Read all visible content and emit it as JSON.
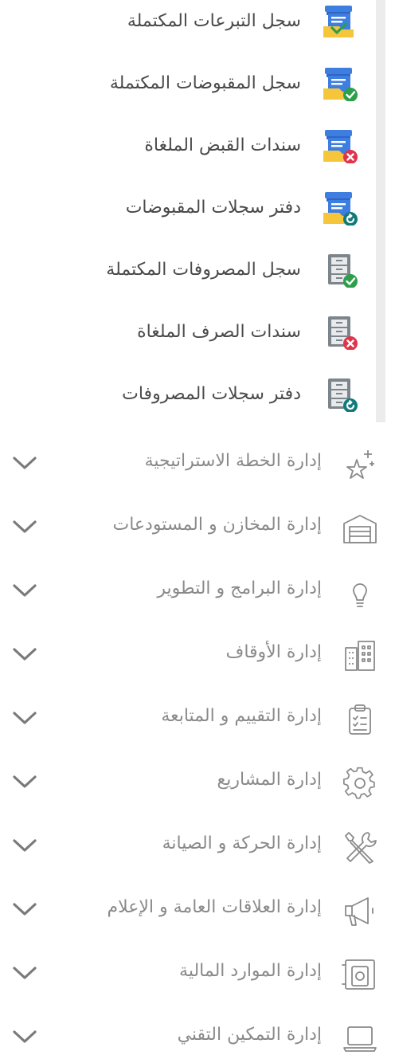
{
  "submenu": [
    {
      "label": "سجل التبرعات المكتملة",
      "icon": "donations-completed-icon"
    },
    {
      "label": "سجل المقبوضات المكتملة",
      "icon": "receipts-completed-icon"
    },
    {
      "label": "سندات القبض الملغاة",
      "icon": "receipts-cancelled-icon"
    },
    {
      "label": "دفتر سجلات المقبوضات",
      "icon": "receipts-ledger-icon"
    },
    {
      "label": "سجل المصروفات المكتملة",
      "icon": "expenses-completed-icon"
    },
    {
      "label": "سندات الصرف الملغاة",
      "icon": "expenses-cancelled-icon"
    },
    {
      "label": "دفتر سجلات المصروفات",
      "icon": "expenses-ledger-icon"
    }
  ],
  "menu": [
    {
      "label": "إدارة الخطة الاستراتيجية",
      "icon": "sparkle-star-icon"
    },
    {
      "label": "إدارة المخازن و المستودعات",
      "icon": "warehouse-icon"
    },
    {
      "label": "إدارة البرامج و التطوير",
      "icon": "lightbulb-icon"
    },
    {
      "label": "إدارة الأوقاف",
      "icon": "buildings-icon"
    },
    {
      "label": "إدارة التقييم و المتابعة",
      "icon": "clipboard-checklist-icon"
    },
    {
      "label": "إدارة المشاريع",
      "icon": "gear-icon"
    },
    {
      "label": "إدارة الحركة و الصيانة",
      "icon": "tools-icon"
    },
    {
      "label": "إدارة العلاقات العامة و الإعلام",
      "icon": "megaphone-icon"
    },
    {
      "label": "إدارة الموارد المالية",
      "icon": "safe-icon"
    },
    {
      "label": "إدارة التمكين التقني",
      "icon": "laptop-icon"
    }
  ],
  "colors": {
    "folder_blue": "#2f66c4",
    "folder_yellow": "#f5c63c",
    "cabinet_gray": "#7c858c",
    "badge_green": "#2e9e4b",
    "badge_red": "#e0344a",
    "badge_teal": "#117a7a"
  }
}
